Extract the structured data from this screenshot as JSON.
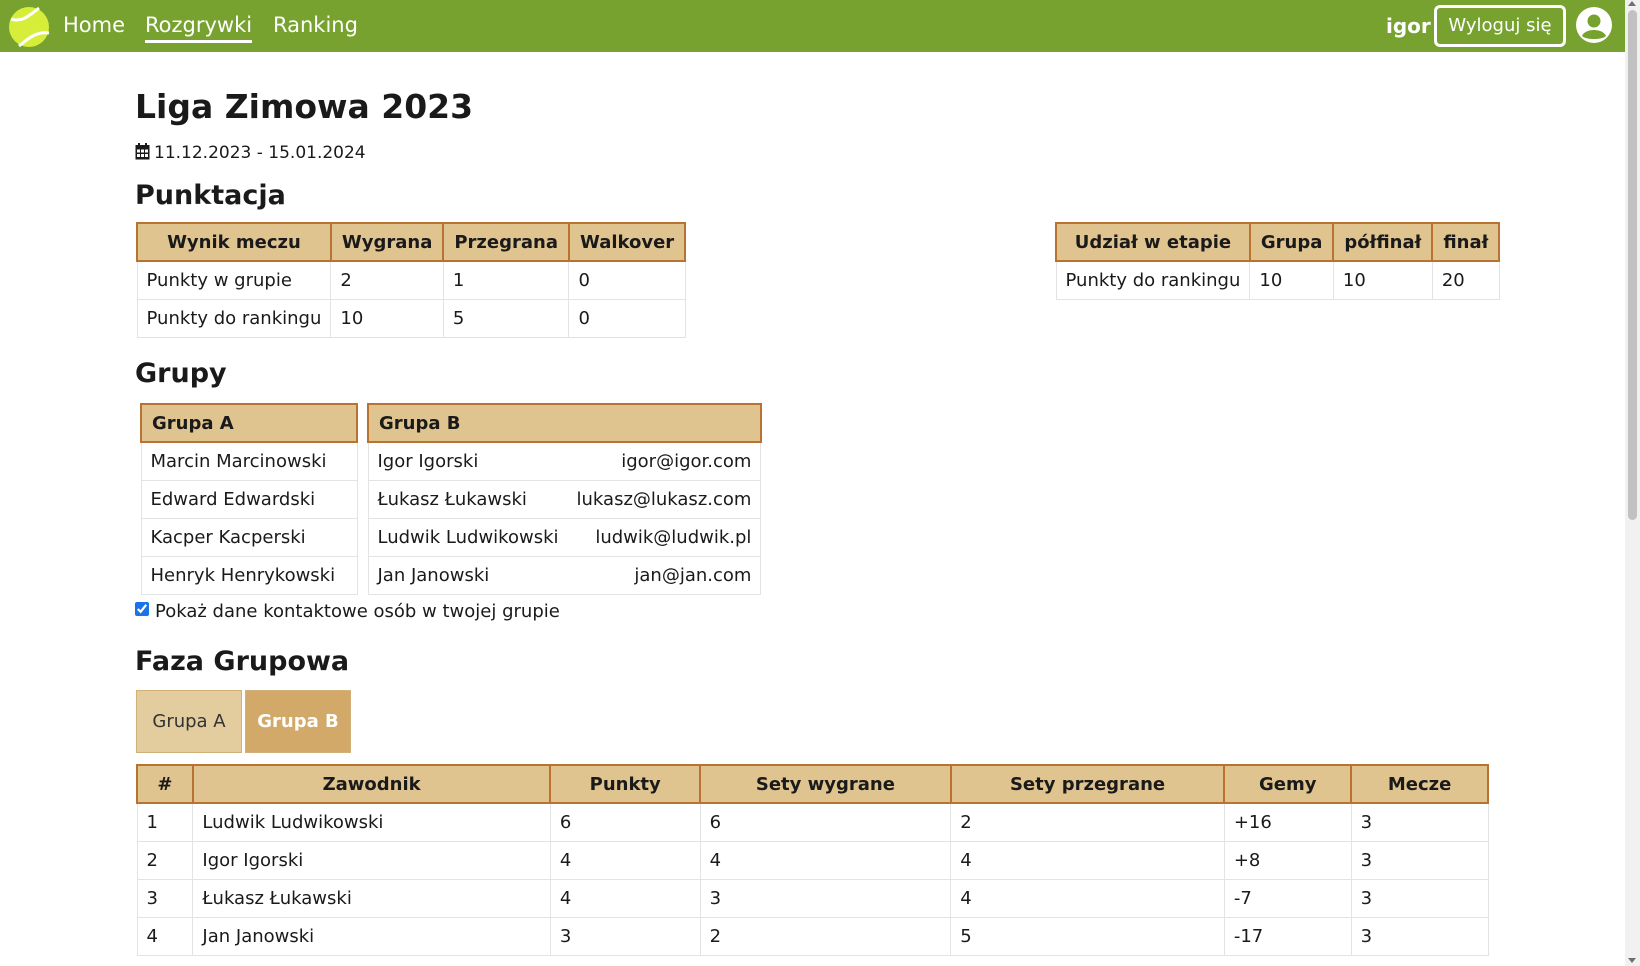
{
  "nav": {
    "links": [
      "Home",
      "Rozgrywki",
      "Ranking"
    ],
    "username": "igor",
    "logout_label": "Wyloguj się"
  },
  "league": {
    "title": "Liga Zimowa 2023",
    "dates": "11.12.2023 - 15.01.2024"
  },
  "scoring": {
    "heading": "Punktacja",
    "match_table": {
      "headers": [
        "Wynik meczu",
        "Wygrana",
        "Przegrana",
        "Walkover"
      ],
      "rows": [
        [
          "Punkty w grupie",
          "2",
          "1",
          "0"
        ],
        [
          "Punkty do rankingu",
          "10",
          "5",
          "0"
        ]
      ]
    },
    "stage_table": {
      "headers": [
        "Udział w etapie",
        "Grupa",
        "półfinał",
        "finał"
      ],
      "rows": [
        [
          "Punkty do rankingu",
          "10",
          "10",
          "20"
        ]
      ]
    }
  },
  "groups": {
    "heading": "Grupy",
    "group_a": {
      "title": "Grupa A",
      "players": [
        "Marcin Marcinowski",
        "Edward Edwardski",
        "Kacper Kacperski",
        "Henryk Henrykowski"
      ]
    },
    "group_b": {
      "title": "Grupa B",
      "players": [
        {
          "name": "Igor Igorski",
          "email": "igor@igor.com"
        },
        {
          "name": "Łukasz Łukawski",
          "email": "lukasz@lukasz.com"
        },
        {
          "name": "Ludwik Ludwikowski",
          "email": "ludwik@ludwik.pl"
        },
        {
          "name": "Jan Janowski",
          "email": "jan@jan.com"
        }
      ]
    },
    "show_contacts_label": "Pokaż dane kontaktowe osób w twojej grupie",
    "show_contacts_checked": true
  },
  "group_phase": {
    "heading": "Faza Grupowa",
    "tabs": [
      "Grupa A",
      "Grupa B"
    ],
    "active_tab": "Grupa B",
    "table": {
      "headers": [
        "#",
        "Zawodnik",
        "Punkty",
        "Sety wygrane",
        "Sety przegrane",
        "Gemy",
        "Mecze"
      ],
      "rows": [
        [
          "1",
          "Ludwik Ludwikowski",
          "6",
          "6",
          "2",
          "+16",
          "3"
        ],
        [
          "2",
          "Igor Igorski",
          "4",
          "4",
          "4",
          "+8",
          "3"
        ],
        [
          "3",
          "Łukasz Łukawski",
          "4",
          "3",
          "4",
          "-7",
          "3"
        ],
        [
          "4",
          "Jan Janowski",
          "3",
          "2",
          "5",
          "-17",
          "3"
        ]
      ]
    }
  },
  "colors": {
    "navbar": "#77a22f",
    "table_header_bg": "#e0c490",
    "table_header_border": "#b87333",
    "active_tab": "#d3a96a"
  }
}
